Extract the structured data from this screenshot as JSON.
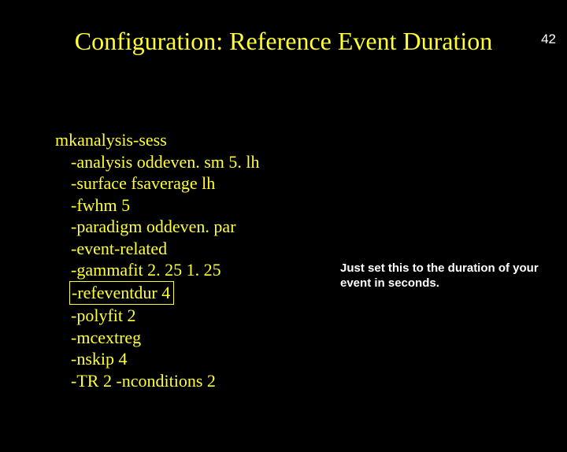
{
  "page_number": "42",
  "title": "Configuration: Reference Event Duration",
  "command": {
    "name": "mkanalysis-sess",
    "args": [
      "-analysis oddeven. sm 5. lh",
      "-surface fsaverage lh",
      "-fwhm 5",
      "-paradigm oddeven. par",
      "-event-related",
      "-gammafit 2. 25 1. 25",
      "-refeventdur 4",
      "-polyfit 2",
      "-mcextreg",
      "-nskip 4",
      "-TR 2 -nconditions 2"
    ],
    "highlight_index": 6
  },
  "note": "Just set this to the duration of your event in seconds."
}
